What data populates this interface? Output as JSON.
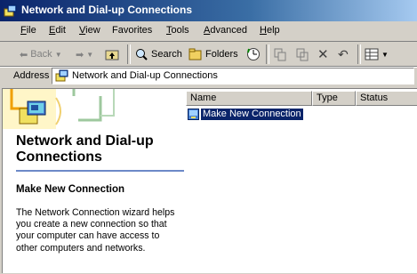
{
  "window": {
    "title": "Network and Dial-up Connections"
  },
  "menu": {
    "items": [
      {
        "first": "F",
        "rest": "ile"
      },
      {
        "first": "E",
        "rest": "dit"
      },
      {
        "first": "V",
        "rest": "iew"
      },
      {
        "first": "F",
        "rest": "avorites",
        "underlineIndex": 2
      },
      {
        "first": "T",
        "rest": "ools"
      },
      {
        "first": "A",
        "rest": "dvanced"
      },
      {
        "first": "H",
        "rest": "elp"
      }
    ]
  },
  "toolbar": {
    "back": "Back",
    "search": "Search",
    "folders": "Folders"
  },
  "address": {
    "label": "Address",
    "value": "Network and Dial-up Connections"
  },
  "leftpane": {
    "title": "Network and Dial-up Connections",
    "subtitle": "Make New Connection",
    "description": "The Network Connection wizard helps you create a new connection so that your computer can have access to other computers and networks."
  },
  "list": {
    "columns": [
      "Name",
      "Type",
      "Status"
    ],
    "rows": [
      {
        "name": "Make New Connection",
        "selected": true
      }
    ]
  },
  "colors": {
    "titlebar": "#0a246a",
    "selection": "#0a246a",
    "accent": "#6d89c8"
  }
}
